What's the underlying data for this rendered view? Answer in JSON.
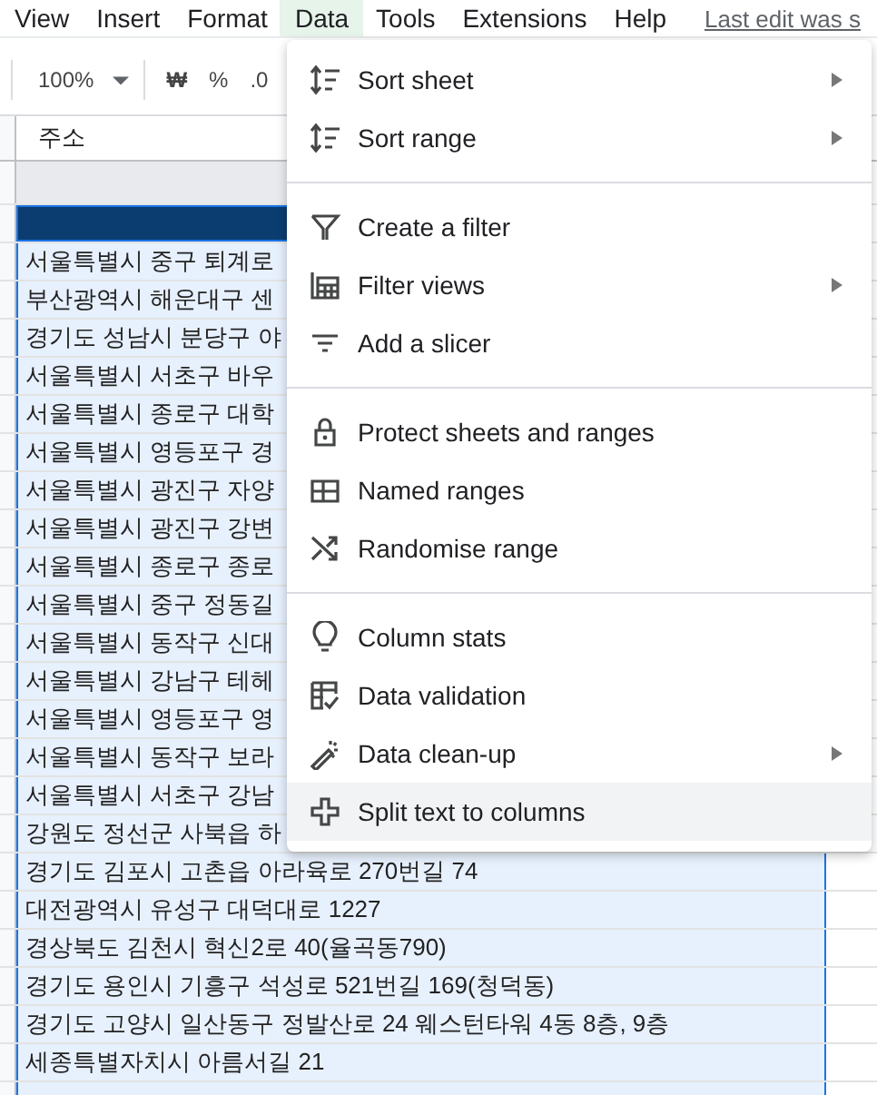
{
  "menubar": [
    {
      "label": "View",
      "selected": false
    },
    {
      "label": "Insert",
      "selected": false
    },
    {
      "label": "Format",
      "selected": false
    },
    {
      "label": "Data",
      "selected": true
    },
    {
      "label": "Tools",
      "selected": false
    },
    {
      "label": "Extensions",
      "selected": false
    },
    {
      "label": "Help",
      "selected": false
    }
  ],
  "last_edit": "Last edit was s",
  "toolbar": {
    "zoom": "100%",
    "currency": "₩",
    "percent": "%",
    "decimal": ".0"
  },
  "column_header": "주소",
  "rows": [
    "서울특별시 중구 퇴계로",
    "부산광역시 해운대구 센",
    "경기도 성남시 분당구 야",
    "서울특별시 서초구 바우",
    "서울특별시 종로구 대학",
    "서울특별시 영등포구 경",
    "서울특별시 광진구 자양",
    "서울특별시 광진구 강변",
    "서울특별시 종로구 종로",
    "서울특별시 중구 정동길",
    "서울특별시 동작구 신대",
    "서울특별시 강남구 테헤",
    "서울특별시 영등포구 영",
    "서울특별시 동작구 보라",
    "서울특별시 서초구 강남",
    "강원도 정선군 사북읍 하",
    "경기도 김포시 고촌읍 아라육로 270번길 74",
    "대전광역시 유성구 대덕대로 1227",
    "경상북도 김천시 혁신2로 40(율곡동790)",
    "경기도 용인시 기흥구 석성로 521번길 169(청덕동)",
    "경기도 고양시 일산동구 정발산로 24 웨스턴타워 4동 8층, 9층",
    "세종특별자치시 아름서길 21"
  ],
  "menu": [
    {
      "kind": "item",
      "label": "Sort sheet",
      "submenu": true,
      "hovered": false
    },
    {
      "kind": "item",
      "label": "Sort range",
      "submenu": true,
      "hovered": false
    },
    {
      "kind": "divider"
    },
    {
      "kind": "item",
      "label": "Create a filter",
      "submenu": false,
      "hovered": false
    },
    {
      "kind": "item",
      "label": "Filter views",
      "submenu": true,
      "hovered": false
    },
    {
      "kind": "item",
      "label": "Add a slicer",
      "submenu": false,
      "hovered": false
    },
    {
      "kind": "divider"
    },
    {
      "kind": "item",
      "label": "Protect sheets and ranges",
      "submenu": false,
      "hovered": false
    },
    {
      "kind": "item",
      "label": "Named ranges",
      "submenu": false,
      "hovered": false
    },
    {
      "kind": "item",
      "label": "Randomise range",
      "submenu": false,
      "hovered": false
    },
    {
      "kind": "divider"
    },
    {
      "kind": "item",
      "label": "Column stats",
      "submenu": false,
      "hovered": false
    },
    {
      "kind": "item",
      "label": "Data validation",
      "submenu": false,
      "hovered": false
    },
    {
      "kind": "item",
      "label": "Data clean-up",
      "submenu": true,
      "hovered": false
    },
    {
      "kind": "item",
      "label": "Split text to columns",
      "submenu": false,
      "hovered": true
    }
  ]
}
